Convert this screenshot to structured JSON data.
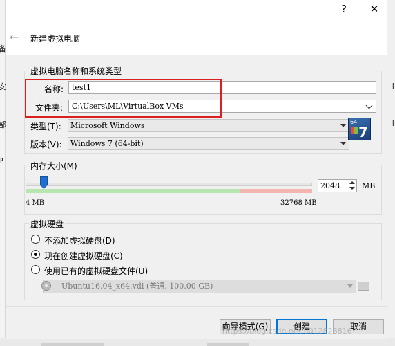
{
  "window": {
    "help_glyph": "?",
    "close_glyph": "✕",
    "back_glyph": "←",
    "title": "新建虚拟电脑"
  },
  "name_group": {
    "title": "虚拟电脑名称和系统类型",
    "name_label": "名称:",
    "name_value": "test1",
    "folder_label": "文件夹:",
    "folder_value": "C:\\Users\\ML\\VirtualBox VMs",
    "type_label": "类型(T):",
    "type_value": "Microsoft Windows",
    "version_label": "版本(V):",
    "version_value": "Windows 7 (64-bit)",
    "os_icon_bits": "64",
    "os_icon_num": "7"
  },
  "memory": {
    "title": "内存大小(M)",
    "min_label": "4 MB",
    "max_label": "32768 MB",
    "value": "2048",
    "unit": "MB",
    "level_fraction": 0.0625
  },
  "disk": {
    "title": "虚拟硬盘",
    "options": [
      {
        "label": "不添加虚拟硬盘(D)",
        "checked": false
      },
      {
        "label": "现在创建虚拟硬盘(C)",
        "checked": true
      },
      {
        "label": "使用已有的虚拟硬盘文件(U)",
        "checked": false
      }
    ],
    "existing_file": "Ubuntu16.04_x64.vdi (普通, 100.00 GB)"
  },
  "buttons": {
    "expert": "向导模式(G)",
    "create": "创建",
    "cancel": "取消"
  },
  "watermark": "https://blog.csdn.net/u012828816",
  "background": {
    "left_chars": [
      "备",
      "安",
      "部",
      "P"
    ],
    "right_chars": [
      "I",
      "I"
    ]
  },
  "colors": {
    "highlight": "#d92020",
    "accent": "#0078d7",
    "slider_thumb": "#1e6fd0"
  }
}
